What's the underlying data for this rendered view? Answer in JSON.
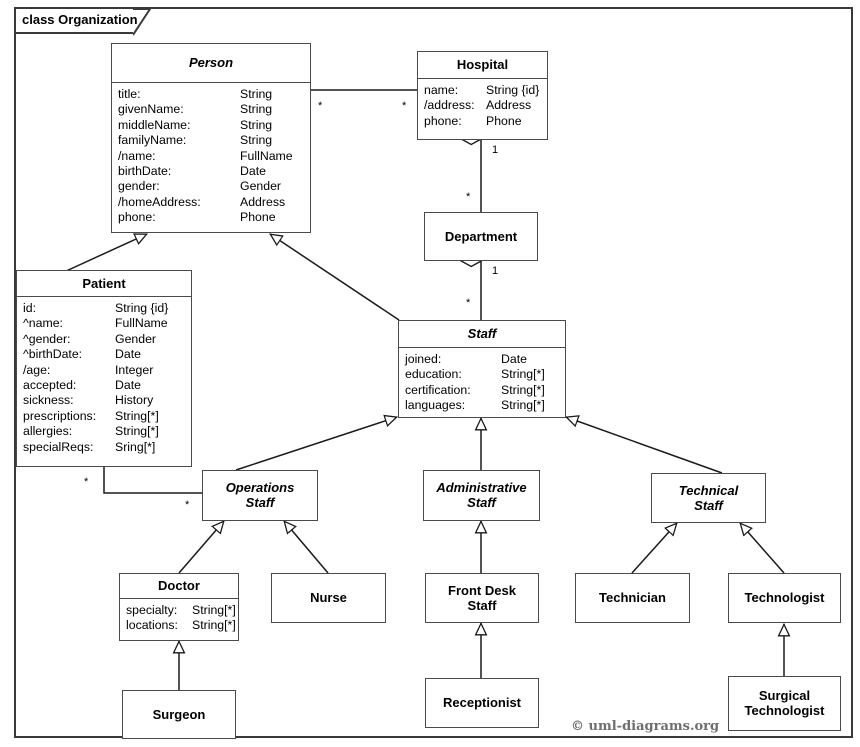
{
  "frame": {
    "label": "class Organization",
    "copyright": "© uml-diagrams.org"
  },
  "classes": {
    "person": {
      "name": "Person",
      "abstract": true,
      "attrs": [
        {
          "name": "title:",
          "type": "String"
        },
        {
          "name": "givenName:",
          "type": "String"
        },
        {
          "name": "middleName:",
          "type": "String"
        },
        {
          "name": "familyName:",
          "type": "String"
        },
        {
          "name": "/name:",
          "type": "FullName"
        },
        {
          "name": "birthDate:",
          "type": "Date"
        },
        {
          "name": "gender:",
          "type": "Gender"
        },
        {
          "name": "/homeAddress:",
          "type": "Address"
        },
        {
          "name": "phone:",
          "type": "Phone"
        }
      ]
    },
    "hospital": {
      "name": "Hospital",
      "abstract": false,
      "attrs": [
        {
          "name": "name:",
          "type": "String {id}"
        },
        {
          "name": "/address:",
          "type": "Address"
        },
        {
          "name": "phone:",
          "type": "Phone"
        }
      ]
    },
    "department": {
      "name": "Department",
      "abstract": false,
      "attrs": []
    },
    "patient": {
      "name": "Patient",
      "abstract": false,
      "attrs": [
        {
          "name": "id:",
          "type": "String {id}"
        },
        {
          "name": "^name:",
          "type": "FullName"
        },
        {
          "name": "^gender:",
          "type": "Gender"
        },
        {
          "name": "^birthDate:",
          "type": "Date"
        },
        {
          "name": "/age:",
          "type": "Integer"
        },
        {
          "name": "accepted:",
          "type": "Date"
        },
        {
          "name": "sickness:",
          "type": "History"
        },
        {
          "name": "prescriptions:",
          "type": "String[*]"
        },
        {
          "name": "allergies:",
          "type": "String[*]"
        },
        {
          "name": "specialReqs:",
          "type": "Sring[*]"
        }
      ]
    },
    "staff": {
      "name": "Staff",
      "abstract": true,
      "attrs": [
        {
          "name": "joined:",
          "type": "Date"
        },
        {
          "name": "education:",
          "type": "String[*]"
        },
        {
          "name": "certification:",
          "type": "String[*]"
        },
        {
          "name": "languages:",
          "type": "String[*]"
        }
      ]
    },
    "operations_staff": {
      "name": "Operations\nStaff",
      "abstract": true,
      "attrs": []
    },
    "administrative_staff": {
      "name": "Administrative\nStaff",
      "abstract": true,
      "attrs": []
    },
    "technical_staff": {
      "name": "Technical\nStaff",
      "abstract": true,
      "attrs": []
    },
    "doctor": {
      "name": "Doctor",
      "abstract": false,
      "attrs": [
        {
          "name": "specialty:",
          "type": "String[*]"
        },
        {
          "name": "locations:",
          "type": "String[*]"
        }
      ]
    },
    "nurse": {
      "name": "Nurse",
      "abstract": false,
      "attrs": []
    },
    "front_desk_staff": {
      "name": "Front Desk\nStaff",
      "abstract": false,
      "attrs": []
    },
    "technician": {
      "name": "Technician",
      "abstract": false,
      "attrs": []
    },
    "technologist": {
      "name": "Technologist",
      "abstract": false,
      "attrs": []
    },
    "surgeon": {
      "name": "Surgeon",
      "abstract": false,
      "attrs": []
    },
    "receptionist": {
      "name": "Receptionist",
      "abstract": false,
      "attrs": []
    },
    "surgical_technologist": {
      "name": "Surgical\nTechnologist",
      "abstract": false,
      "attrs": []
    }
  },
  "multiplicities": {
    "person_hospital_source": "*",
    "person_hospital_target": "*",
    "hospital_department_one": "1",
    "hospital_department_many": "*",
    "department_staff_one": "1",
    "department_staff_many": "*",
    "patient_operations_source": "*",
    "patient_operations_target": "*"
  },
  "relationships": [
    {
      "kind": "association",
      "from": "Person",
      "to": "Hospital",
      "from_mult": "*",
      "to_mult": "*"
    },
    {
      "kind": "composition",
      "whole": "Hospital",
      "part": "Department",
      "whole_mult": "1",
      "part_mult": "*"
    },
    {
      "kind": "composition",
      "whole": "Department",
      "part": "Staff",
      "whole_mult": "1",
      "part_mult": "*"
    },
    {
      "kind": "association",
      "from": "Patient",
      "to": "Operations Staff",
      "from_mult": "*",
      "to_mult": "*"
    },
    {
      "kind": "generalization",
      "child": "Patient",
      "parent": "Person"
    },
    {
      "kind": "generalization",
      "child": "Staff",
      "parent": "Person"
    },
    {
      "kind": "generalization",
      "child": "Operations Staff",
      "parent": "Staff"
    },
    {
      "kind": "generalization",
      "child": "Administrative Staff",
      "parent": "Staff"
    },
    {
      "kind": "generalization",
      "child": "Technical Staff",
      "parent": "Staff"
    },
    {
      "kind": "generalization",
      "child": "Doctor",
      "parent": "Operations Staff"
    },
    {
      "kind": "generalization",
      "child": "Nurse",
      "parent": "Operations Staff"
    },
    {
      "kind": "generalization",
      "child": "Front Desk Staff",
      "parent": "Administrative Staff"
    },
    {
      "kind": "generalization",
      "child": "Technician",
      "parent": "Technical Staff"
    },
    {
      "kind": "generalization",
      "child": "Technologist",
      "parent": "Technical Staff"
    },
    {
      "kind": "generalization",
      "child": "Surgeon",
      "parent": "Doctor"
    },
    {
      "kind": "generalization",
      "child": "Receptionist",
      "parent": "Front Desk Staff"
    },
    {
      "kind": "generalization",
      "child": "Surgical Technologist",
      "parent": "Technologist"
    }
  ]
}
